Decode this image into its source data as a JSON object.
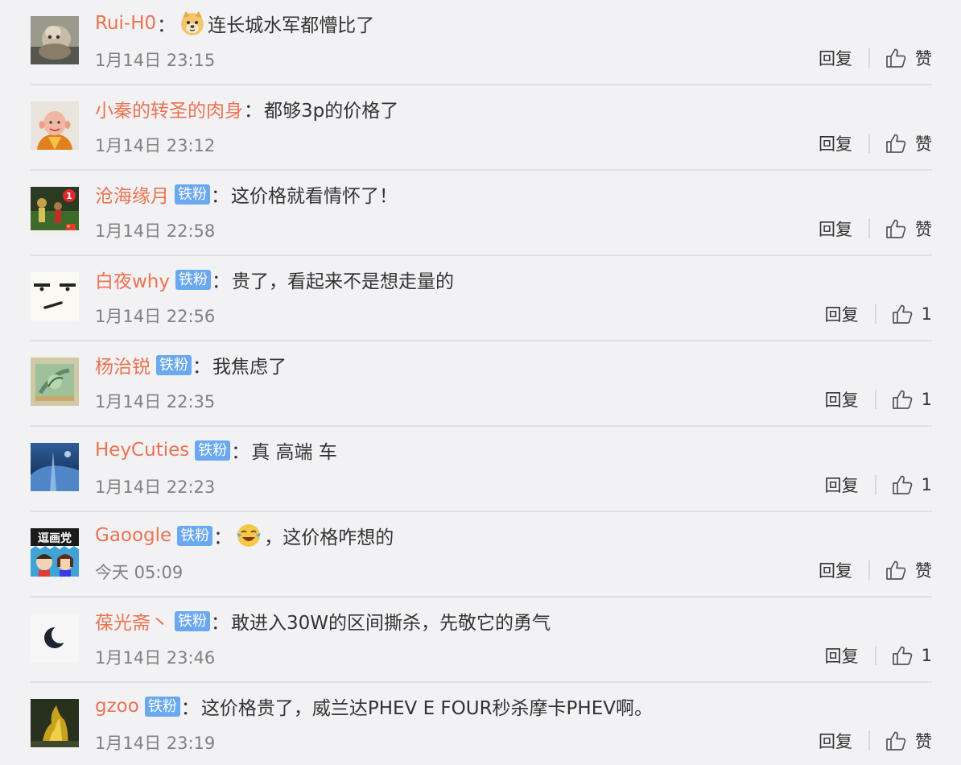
{
  "comments": [
    {
      "avatar": "monkey-photo-avatar",
      "user": "Rui-H0",
      "badge": "",
      "colon": "：",
      "emoji_before": "doge-emoji",
      "text": "连长城水军都懵比了",
      "time": "1月14日 23:15",
      "reply": "回复",
      "like": "赞"
    },
    {
      "avatar": "cartoon-monk-avatar",
      "user": "小秦的转圣的肉身",
      "badge": "",
      "colon": "：",
      "emoji_before": "",
      "text": "都够3p的价格了",
      "time": "1月14日 23:12",
      "reply": "回复",
      "like": "赞"
    },
    {
      "avatar": "football-poster-avatar",
      "user": "沧海缘月",
      "badge": "铁粉",
      "colon": "：",
      "emoji_before": "",
      "text": "这价格就看情怀了！",
      "time": "1月14日 22:58",
      "reply": "回复",
      "like": "赞"
    },
    {
      "avatar": "meh-face-avatar",
      "user": "白夜why",
      "badge": "铁粉",
      "colon": "：",
      "emoji_before": "",
      "text": "贵了，看起来不是想走量的",
      "time": "1月14日 22:56",
      "reply": "回复",
      "like": "1"
    },
    {
      "avatar": "green-illustration-avatar",
      "user": "杨治锐",
      "badge": "铁粉",
      "colon": "：",
      "emoji_before": "",
      "text": "我焦虑了",
      "time": "1月14日 22:35",
      "reply": "回复",
      "like": "1"
    },
    {
      "avatar": "blue-night-avatar",
      "user": "HeyCuties",
      "badge": "铁粉",
      "colon": "：",
      "emoji_before": "",
      "text": "真 高端 车",
      "time": "1月14日 22:23",
      "reply": "回复",
      "like": "1"
    },
    {
      "avatar": "comic-party-avatar",
      "user": "Gaoogle",
      "badge": "铁粉",
      "colon": "：",
      "emoji_before": "laugh-cry-emoji",
      "text": "，这价格咋想的",
      "time": "今天 05:09",
      "reply": "回复",
      "like": "赞"
    },
    {
      "avatar": "crescent-moon-avatar",
      "user": "葆光斋丶",
      "badge": "铁粉",
      "colon": "：",
      "emoji_before": "",
      "text": "敢进入30W的区间撕杀，先敬它的勇气",
      "time": "1月14日 23:46",
      "reply": "回复",
      "like": "1"
    },
    {
      "avatar": "golden-fire-avatar",
      "user": "gzoo",
      "badge": "铁粉",
      "colon": "：",
      "emoji_before": "",
      "text": "这价格贵了，威兰达PHEV E FOUR秒杀摩卡PHEV啊。",
      "time": "1月14日 23:19",
      "reply": "回复",
      "like": "赞"
    }
  ],
  "icons": {
    "like": "thumbs-up-icon"
  },
  "colors": {
    "background": "#f2f2f5",
    "username": "#eb7350",
    "badge": "#6aa8ef",
    "text": "#333333",
    "time": "#808080",
    "divider": "#e1e1e4"
  }
}
